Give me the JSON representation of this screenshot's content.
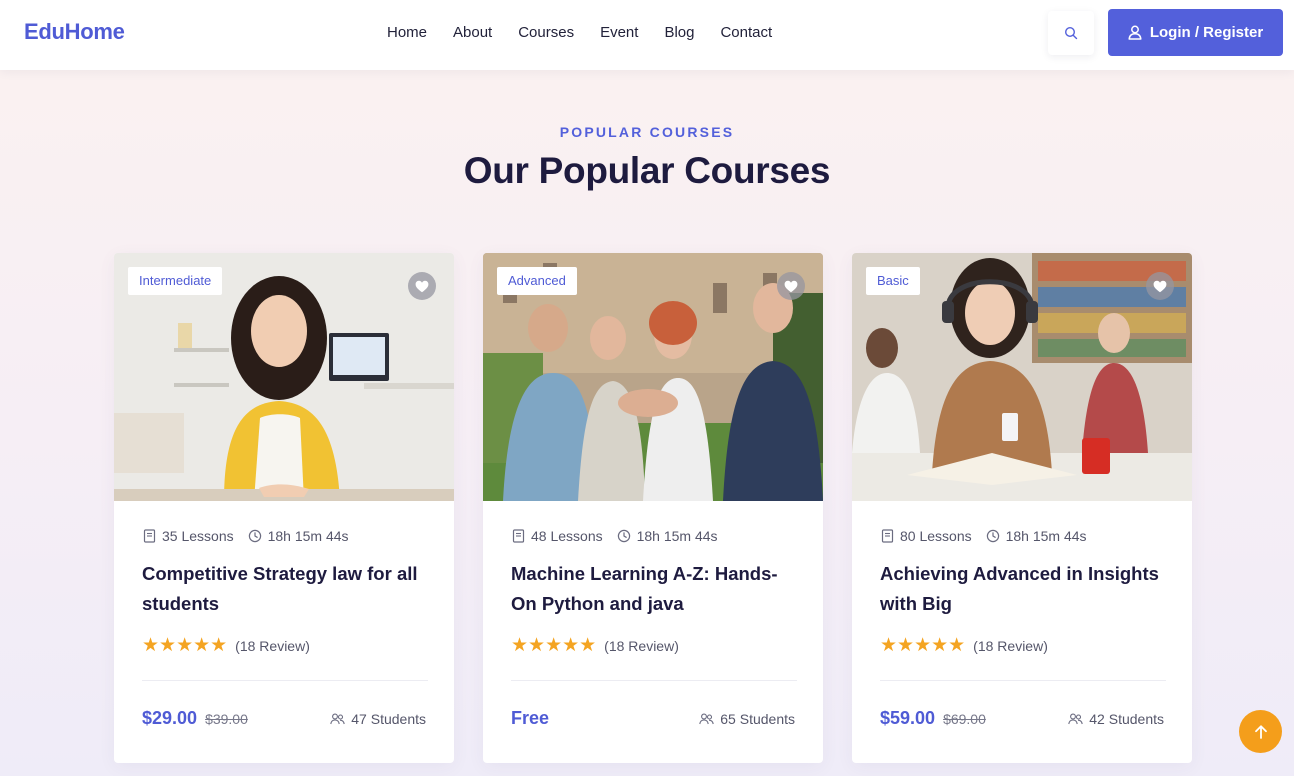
{
  "header": {
    "logo": "EduHome",
    "nav": [
      "Home",
      "About",
      "Courses",
      "Event",
      "Blog",
      "Contact"
    ],
    "search_icon": "search-icon",
    "login_label": "Login / Register",
    "login_icon": "user-icon"
  },
  "section": {
    "kicker": "POPULAR COURSES",
    "title": "Our Popular Courses"
  },
  "courses": [
    {
      "level": "Intermediate",
      "lessons": "35 Lessons",
      "duration": "18h 15m 44s",
      "title": "Competitive Strategy law for all students",
      "rating_stars": 5,
      "reviews": "(18 Review)",
      "price": "$29.00",
      "old_price": "$39.00",
      "students": "47 Students"
    },
    {
      "level": "Advanced",
      "lessons": "48 Lessons",
      "duration": "18h 15m 44s",
      "title": "Machine Learning A-Z: Hands-On Python and java",
      "rating_stars": 5,
      "reviews": "(18 Review)",
      "price": "Free",
      "old_price": "",
      "students": "65 Students"
    },
    {
      "level": "Basic",
      "lessons": "80 Lessons",
      "duration": "18h 15m 44s",
      "title": "Achieving Advanced in Insights with Big",
      "rating_stars": 5,
      "reviews": "(18 Review)",
      "price": "$59.00",
      "old_price": "$69.00",
      "students": "42 Students"
    }
  ],
  "colors": {
    "accent": "#5360db",
    "star": "#f4a422",
    "scroll_top": "#f49e1b"
  },
  "scroll_top_icon": "arrow-up-icon"
}
